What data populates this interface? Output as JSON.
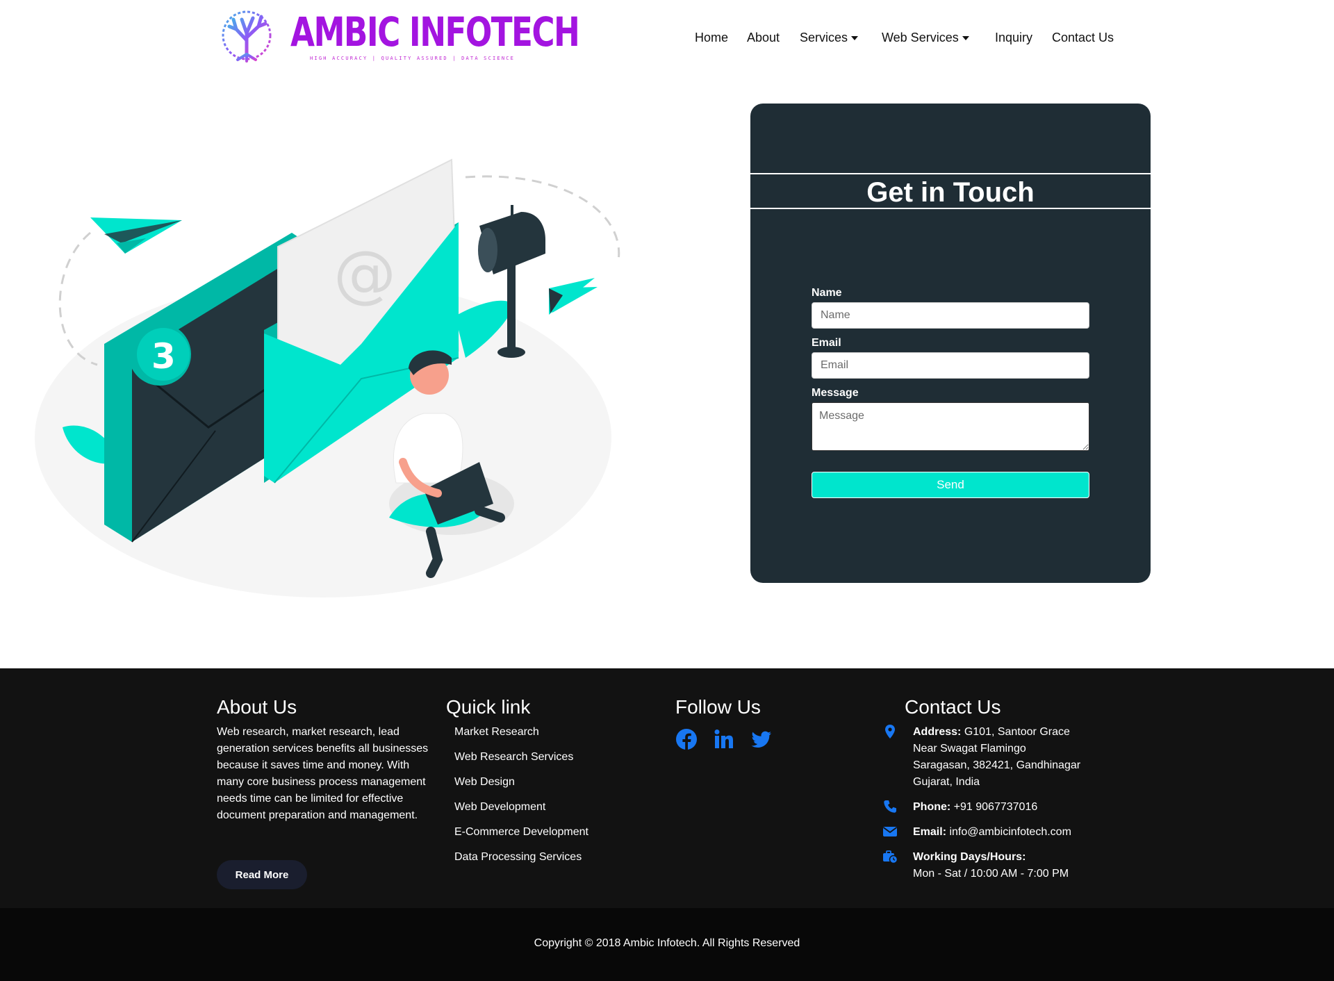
{
  "brand": {
    "name": "AMBIC INFOTECH",
    "tagline": "HIGH ACCURACY | QUALITY ASSURED | DATA SCIENCE",
    "colors": {
      "primary": "#a314e0",
      "accent": "#00e5cd",
      "card_bg": "#1f2d35",
      "footer_bg": "#121212",
      "icon_blue": "#1877f2"
    }
  },
  "nav": {
    "home": "Home",
    "about": "About",
    "services": "Services",
    "web_services": "Web Services",
    "inquiry": "Inquiry",
    "contact": "Contact Us"
  },
  "illustration": {
    "badge_number": "3",
    "at_symbol": "@"
  },
  "form": {
    "title": "Get in Touch",
    "name_label": "Name",
    "name_placeholder": "Name",
    "email_label": "Email",
    "email_placeholder": "Email",
    "message_label": "Message",
    "message_placeholder": "Message",
    "send_label": "Send"
  },
  "footer": {
    "about": {
      "title": "About Us",
      "lines": [
        "Web research, market research, lead",
        "generation services benefits all businesses",
        "because it saves time and money. With",
        "many core business process management",
        "needs time can be limited for effective",
        "document preparation and management."
      ],
      "button": "Read More"
    },
    "quick": {
      "title": "Quick link",
      "links": [
        "Market Research",
        "Web Research Services",
        "Web Design",
        "Web Development",
        "E-Commerce Development",
        "Data Processing Services"
      ]
    },
    "follow": {
      "title": "Follow Us",
      "icons": [
        "facebook-icon",
        "linkedin-icon",
        "twitter-icon"
      ]
    },
    "contact": {
      "title": "Contact Us",
      "address_label": "Address:",
      "address_lines": [
        "G101, Santoor Grace",
        "Near Swagat Flamingo",
        "Saragasan, 382421, Gandhinagar",
        "Gujarat, India"
      ],
      "phone_label": "Phone:",
      "phone": "+91 9067737016",
      "email_label": "Email:",
      "email": "info@ambicinfotech.com",
      "hours_label": "Working Days/Hours:",
      "hours": "Mon - Sat / 10:00 AM - 7:00 PM"
    },
    "copyright": "Copyright © 2018 Ambic Infotech. All Rights Reserved"
  }
}
